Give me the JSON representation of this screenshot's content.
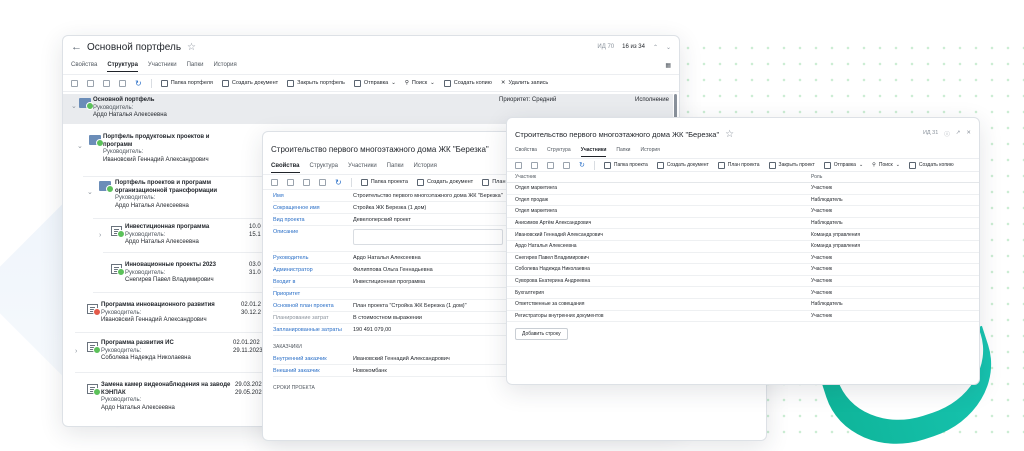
{
  "portfolio": {
    "title": "Основной портфель",
    "id_label": "ИД 70",
    "counter": "16 из 34",
    "tabs": [
      "Свойства",
      "Структура",
      "Участники",
      "Папки",
      "История"
    ],
    "active_tab": "Структура",
    "toolbar": [
      "Папка портфеля",
      "Создать документ",
      "Закрыть портфель",
      "Отправка",
      "Поиск",
      "Создать копию",
      "Удалить запись"
    ],
    "nodes": [
      {
        "name": "Основной портфель",
        "role": "Руководитель:",
        "person": "Ардо Наталья Алексеевна",
        "priority": "Приоритет: Средний",
        "status": "Исполнение"
      },
      {
        "name1": "Портфель продуктовых проектов и",
        "name2": "программ",
        "role": "Руководитель:",
        "person": "Ивановский Геннадий Александрович"
      },
      {
        "name1": "Портфель проектов и программ",
        "name2": "организационной трансформации",
        "role": "Руководитель:",
        "person": "Ардо Наталья Алексеевна"
      },
      {
        "name": "Инвестиционная программа",
        "role": "Руководитель:",
        "person": "Ардо Наталья Алексеевна",
        "d1": "10.0",
        "d2": "15.1"
      },
      {
        "name": "Инновационные  проекты 2023",
        "role": "Руководитель:",
        "person": "Снегирев Павел Владимирович",
        "d1": "03.0",
        "d2": "31.0"
      },
      {
        "name": "Программа инновационного развития",
        "role": "Руководитель:",
        "person": "Ивановский Геннадий Александрович",
        "d1": "02.01.2",
        "d2": "30.12.2"
      },
      {
        "name": "Программа развития ИС",
        "role": "Руководитель:",
        "person": "Соболева Надежда Николаевна",
        "d1": "02.01.202",
        "d2": "29.11.2023"
      },
      {
        "name1": "Замена камер видеонаблюдения на заводе",
        "name2": "КЭНПАК",
        "role": "Руководитель:",
        "person": "Ардо Наталья Алексеевна",
        "d1": "29.03.202",
        "d2": "29.05.202"
      }
    ]
  },
  "project": {
    "title": "Строительство первого многоэтажного дома ЖК \"Березка\"",
    "tabs": [
      "Свойства",
      "Структура",
      "Участники",
      "Папки",
      "История"
    ],
    "active_tab": "Свойства",
    "toolbar": [
      "Папка проекта",
      "Создать документ",
      "План пр"
    ],
    "fields": [
      {
        "label": "Имя",
        "value": "Строительство первого многоэтажного дома ЖК \"Березка\""
      },
      {
        "label": "Сокращенное имя",
        "value": "Стройка ЖК Березка (1 дом)"
      },
      {
        "label": "Вид проекта",
        "value": "Девелоперский проект"
      },
      {
        "label": "Описание",
        "value": ""
      },
      {
        "label": "Руководитель",
        "value": "Ардо Наталья Алексеевна"
      },
      {
        "label": "Администратор",
        "value": "Филиппова Ольга Геннадьевна"
      },
      {
        "label": "Входит в",
        "value": "Инвестиционная программа"
      },
      {
        "label": "Приоритет",
        "value": ""
      },
      {
        "label": "Основной план проекта",
        "value": "План проекта \"Стройка ЖК Березка (1 дом)\""
      },
      {
        "label": "Планирование затрат",
        "value": "В стоимостном выражении"
      },
      {
        "label": "Запланированные затраты",
        "value": "190 491 079,00"
      }
    ],
    "section_customers": "ЗАКАЗЧИКИ",
    "customers": [
      {
        "label": "Внутренний заказчик",
        "value": "Ивановский Геннадий Александрович"
      },
      {
        "label": "Внешний заказчик",
        "value": "Новокомбанк"
      }
    ],
    "section_dates": "СРОКИ ПРОЕКТА"
  },
  "participants": {
    "title": "Строительство первого многоэтажного дома ЖК \"Березка\"",
    "id_label": "ИД 31",
    "tabs": [
      "Свойства",
      "Структура",
      "Участники",
      "Папки",
      "История"
    ],
    "active_tab": "Участники",
    "toolbar": [
      "Папка проекта",
      "Создать документ",
      "План проекта",
      "Закрыть проект",
      "Отправка",
      "Поиск",
      "Создать копию"
    ],
    "col_participant": "Участник",
    "col_role": "Роль",
    "rows": [
      {
        "p": "Отдел маркетинга",
        "r": "Участник"
      },
      {
        "p": "Отдел продаж",
        "r": "Наблюдатель"
      },
      {
        "p": "Отдел маркетинга",
        "r": "Участник"
      },
      {
        "p": "Анисимов Артём Александрович",
        "r": "Наблюдатель"
      },
      {
        "p": "Ивановский Геннадий Александрович",
        "r": "Команда управления"
      },
      {
        "p": "Ардо Наталья Алексеевна",
        "r": "Команда управления"
      },
      {
        "p": "Снегирев Павел Владимирович",
        "r": "Участник"
      },
      {
        "p": "Соболева Надежда Николаевна",
        "r": "Участник"
      },
      {
        "p": "Суворова Екатерина Андреевна",
        "r": "Участник"
      },
      {
        "p": "Бухгалтерия",
        "r": "Участник"
      },
      {
        "p": "Ответственные за совещания",
        "r": "Наблюдатель"
      },
      {
        "p": "Регистраторы внутренних документов",
        "r": "Участник"
      }
    ],
    "add_row": "Добавить строку"
  }
}
